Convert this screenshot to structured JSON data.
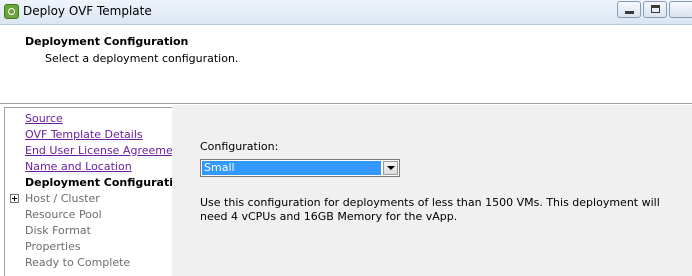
{
  "window": {
    "title": "Deploy OVF Template"
  },
  "header": {
    "title": "Deployment Configuration",
    "subtitle": "Select a deployment configuration."
  },
  "nav": {
    "items": [
      {
        "label": "Source",
        "state": "link"
      },
      {
        "label": "OVF Template Details",
        "state": "link"
      },
      {
        "label": "End User License Agreement",
        "state": "link"
      },
      {
        "label": "Name and Location",
        "state": "link"
      },
      {
        "label": "Deployment Configuration",
        "state": "current"
      },
      {
        "label": "Host / Cluster",
        "state": "future"
      },
      {
        "label": "Resource Pool",
        "state": "future"
      },
      {
        "label": "Disk Format",
        "state": "future"
      },
      {
        "label": "Properties",
        "state": "future"
      },
      {
        "label": "Ready to Complete",
        "state": "future"
      }
    ]
  },
  "content": {
    "config_label": "Configuration:",
    "config_selected": "Small",
    "description": "Use this configuration for deployments of less than 1500 VMs. This deployment will need 4 vCPUs and 16GB Memory for the vApp."
  },
  "colors": {
    "link": "#6b1f9e",
    "selection": "#3399ff",
    "content_bg": "#f0f0f0"
  }
}
